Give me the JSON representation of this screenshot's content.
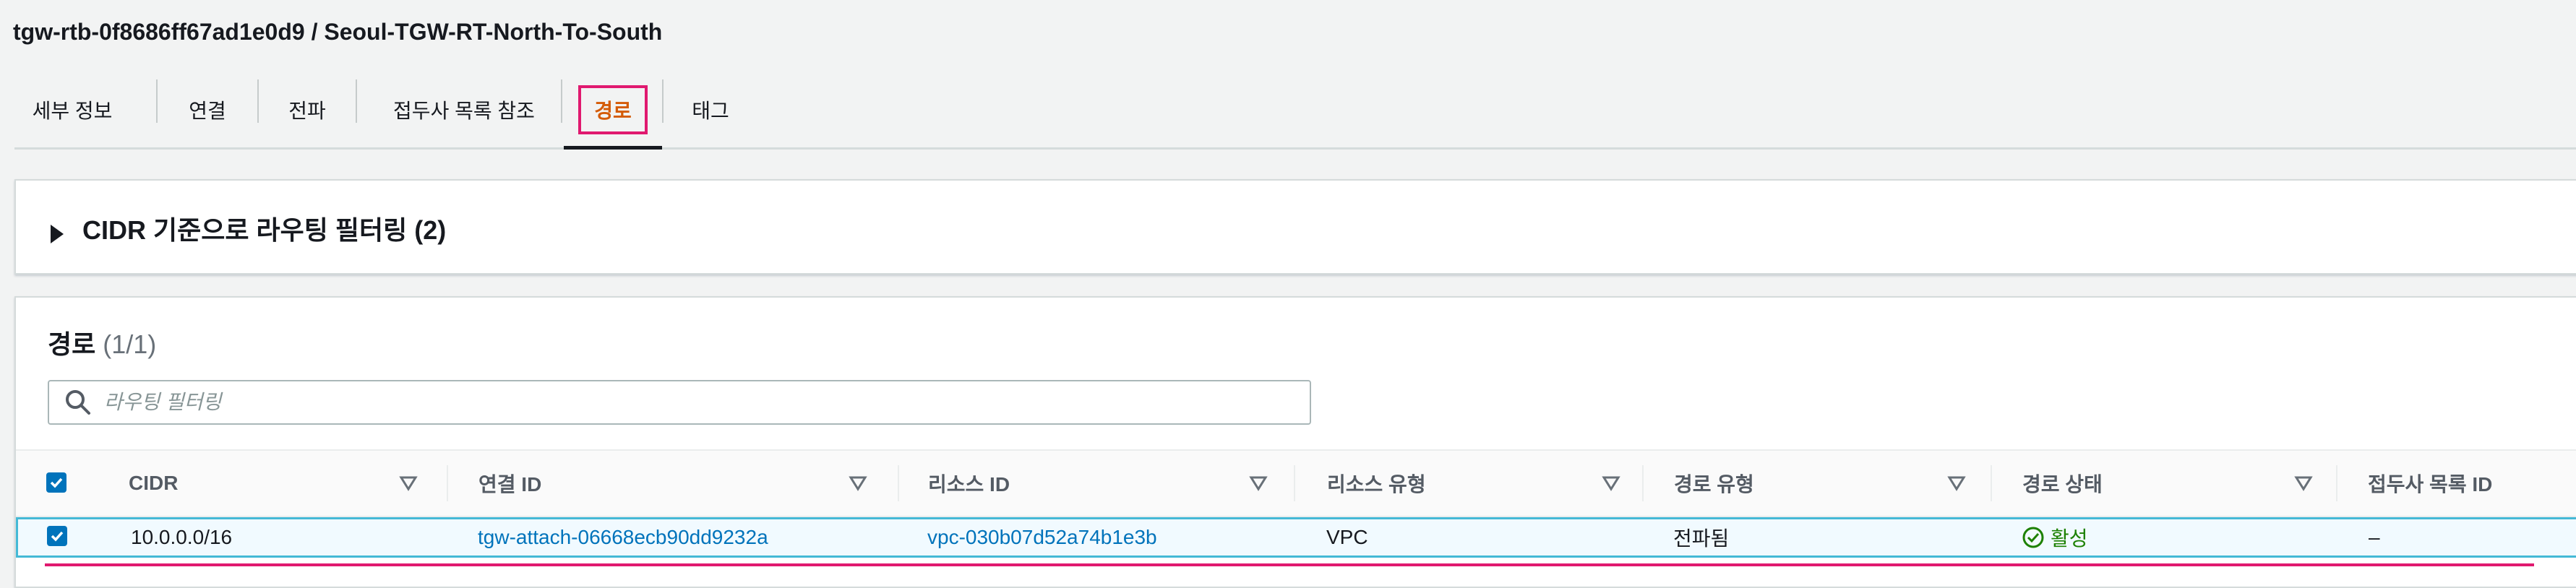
{
  "page": {
    "title": "tgw-rtb-0f8686ff67ad1e0d9 / Seoul-TGW-RT-North-To-South"
  },
  "tabs": [
    {
      "label": "세부 정보"
    },
    {
      "label": "연결"
    },
    {
      "label": "전파"
    },
    {
      "label": "접두사 목록 참조"
    },
    {
      "label": "경로",
      "active": true
    },
    {
      "label": "태그"
    }
  ],
  "cidr_filter": {
    "label": "CIDR 기준으로 라우팅 필터링 (2)"
  },
  "routes": {
    "title": "경로",
    "count": "(1/1)",
    "search_placeholder": "라우팅 필터링",
    "columns": [
      "CIDR",
      "연결 ID",
      "리소스 ID",
      "리소스 유형",
      "경로 유형",
      "경로 상태",
      "접두사 목록 ID"
    ],
    "rows": [
      {
        "selected": true,
        "cidr": "10.0.0.0/16",
        "attachment_id": "tgw-attach-06668ecb90dd9232a",
        "resource_id": "vpc-030b07d52a74b1e3b",
        "resource_type": "VPC",
        "route_type": "전파됨",
        "route_state": "활성",
        "prefix_list_id": "–"
      }
    ]
  },
  "colors": {
    "accent_orange": "#d45b07",
    "highlight_pink": "#e0196f",
    "link_blue": "#0073bb",
    "status_green": "#1d8102",
    "row_border": "#44b9d6"
  },
  "icons": {
    "expand": "caret-right-icon",
    "search": "search-icon",
    "sort": "sort-down-icon",
    "checkbox": "checkbox-checked-icon",
    "status": "check-circle-icon"
  }
}
